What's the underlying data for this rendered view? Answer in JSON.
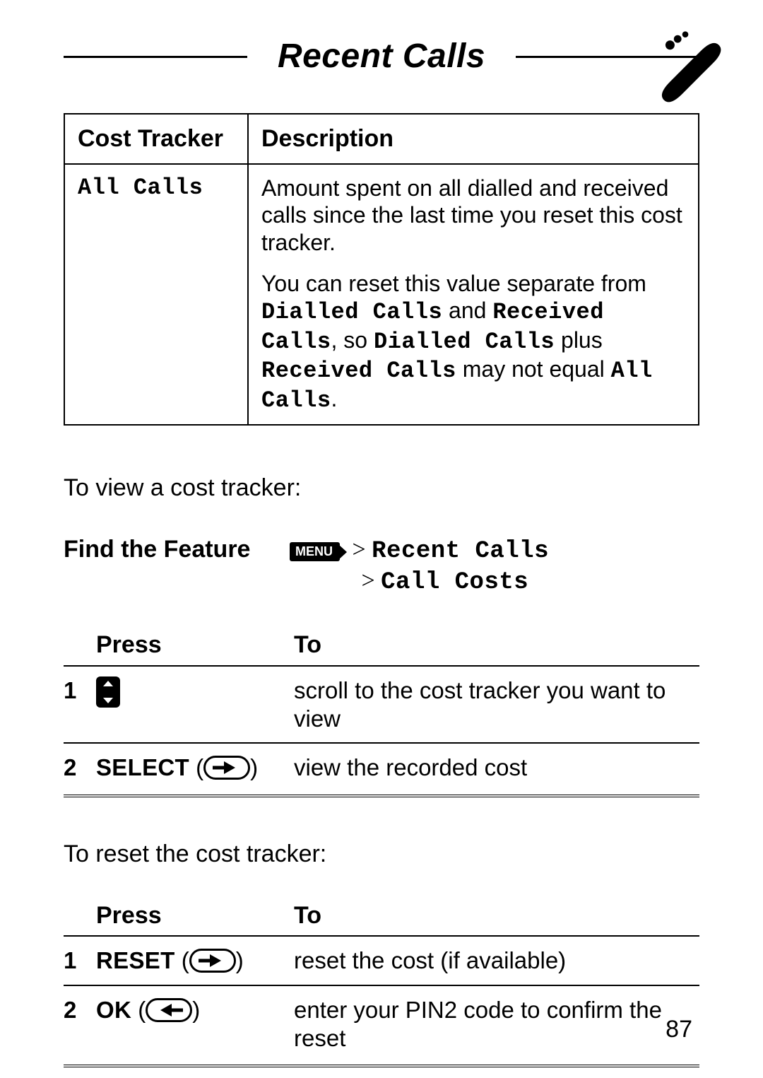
{
  "header": {
    "title": "Recent Calls"
  },
  "cost_tracker_table": {
    "headers": {
      "col1": "Cost Tracker",
      "col2": "Description"
    },
    "row": {
      "name": "All Calls",
      "para1": "Amount spent on all dialled and received calls since the last time you reset this cost tracker.",
      "p2a": "You can reset this value separate from ",
      "p2b": "Dialled Calls",
      "p2c": " and ",
      "p2d": "Received Calls",
      "p2e": ", so ",
      "p2f": "Dialled Calls",
      "p2g": " plus ",
      "p2h": "Received Calls",
      "p2i": " may not equal ",
      "p2j": "All Calls",
      "p2k": "."
    }
  },
  "view_intro": "To view a cost tracker:",
  "feature": {
    "label": "Find the Feature",
    "menu_label": "MENU",
    "gt1": " > ",
    "recent": "Recent Calls",
    "gt2": "> ",
    "costs": "Call Costs"
  },
  "steps_headers": {
    "press": "Press",
    "to": "To"
  },
  "view_steps": [
    {
      "num": "1",
      "label": "",
      "to": "scroll to the cost tracker you want to view",
      "icon": "navkey"
    },
    {
      "num": "2",
      "label": "SELECT",
      "to": "view the recorded cost",
      "icon": "sk-right"
    }
  ],
  "reset_intro": "To reset the cost tracker:",
  "reset_steps": [
    {
      "num": "1",
      "label": "RESET",
      "to": "reset the cost (if available)",
      "icon": "sk-right"
    },
    {
      "num": "2",
      "label": "OK",
      "to": "enter your PIN2 code to confirm the reset",
      "icon": "sk-left"
    }
  ],
  "page_number": "87"
}
